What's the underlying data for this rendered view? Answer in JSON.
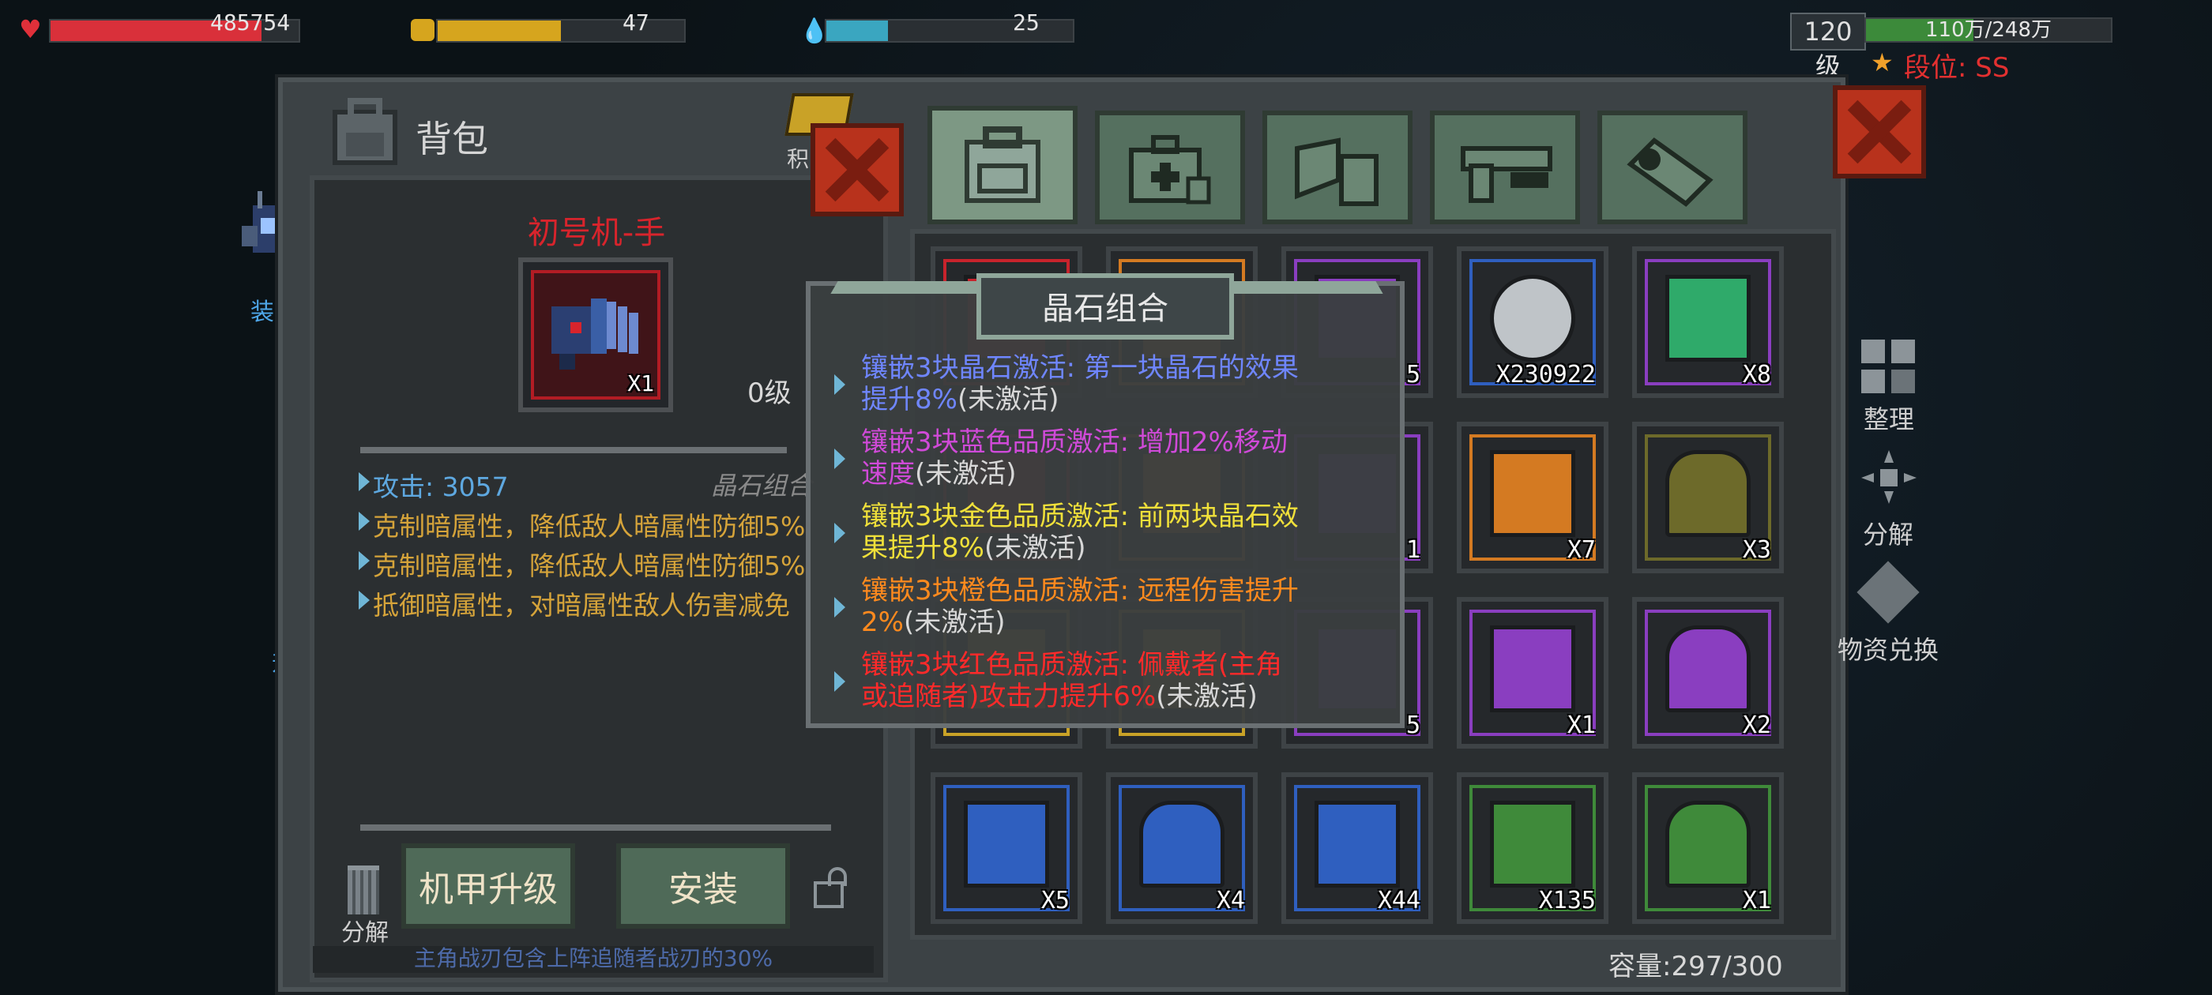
{
  "hud": {
    "hp_value": "485754",
    "food_value": "47",
    "water_value": "25",
    "hp_fraction": 0.85,
    "food_fraction": 0.5,
    "water_fraction": 0.25,
    "level_badge": "120级",
    "exp_text": "110万/248万",
    "exp_fraction": 0.44,
    "rank_label": "段位: SS",
    "colors": {
      "hp": "#d9303a",
      "food": "#d6a51e",
      "water": "#3aa6c0"
    }
  },
  "left_nav": {
    "equip_label": "装备",
    "upgrade_label": "升级",
    "peek_label": "积"
  },
  "backpack": {
    "title": "背包",
    "item_name": "初号机-手",
    "item_qty": "X1",
    "item_level": "0级",
    "stats": [
      {
        "text": "攻击: 3057",
        "color": "#5ea8e0"
      },
      {
        "text": "克制暗属性，降低敌人暗属性防御5%",
        "color": "#d6a43a"
      },
      {
        "text": "克制暗属性，降低敌人暗属性防御5%",
        "color": "#d6a43a"
      },
      {
        "text": "抵御暗属性，对暗属性敌人伤害减免",
        "color": "#d6a43a"
      }
    ],
    "gem_combo_label": "晶石组合",
    "footer_text": "主角战刃包含上阵追随者战刃的30%",
    "decompose_label": "分解",
    "upgrade_button": "机甲升级",
    "install_button": "安装"
  },
  "tabs": [
    "backpack-icon",
    "medkit-icon",
    "material-icon",
    "gun-icon",
    "wrench-icon"
  ],
  "tooltip": {
    "title": "晶石组合",
    "entries": [
      {
        "text": "镶嵌3块晶石激活: 第一块晶石的效果提升8%",
        "line1": "镶嵌3块晶石激活: 第一块晶石的效果",
        "line2": "提升8%",
        "status": "(未激活)",
        "color": "#6f86ff"
      },
      {
        "text": "镶嵌3块蓝色品质激活: 增加2%移动速度",
        "line1": "镶嵌3块蓝色品质激活: 增加2%移动",
        "line2": "速度",
        "status": "(未激活)",
        "color": "#d04ad8"
      },
      {
        "text": "镶嵌3块金色品质激活: 前两块晶石效果提升8%",
        "line1": "镶嵌3块金色品质激活: 前两块晶石效",
        "line2": "果提升8%",
        "status": "(未激活)",
        "color": "#f0e03a"
      },
      {
        "text": "镶嵌3块橙色品质激活: 远程伤害提升2%",
        "line1": "镶嵌3块橙色品质激活: 远程伤害提升",
        "line2": "2%",
        "status": "(未激活)",
        "color": "#ff8a1e"
      },
      {
        "text": "镶嵌3块红色品质激活: 佩戴者(主角或追随者)攻击力提升6%",
        "line1": "镶嵌3块红色品质激活: 佩戴者(主角",
        "line2": "或追随者)攻击力提升6%",
        "status": "(未激活)",
        "color": "#ff2a2a"
      }
    ]
  },
  "inventory": {
    "rows": [
      [
        {
          "icon": "hidden-item-icon",
          "rarity": "#c8232c",
          "qty": ""
        },
        {
          "icon": "hidden-item-icon",
          "rarity": "#d47a22",
          "qty": ""
        },
        {
          "icon": "hidden-item-icon",
          "rarity": "#8a3ec0",
          "qty": "5"
        },
        {
          "icon": "silver-coin-icon",
          "rarity": "#2f5fbf",
          "qty": "X230922"
        },
        {
          "icon": "green-tool-card-icon",
          "rarity": "#8a3ec0",
          "qty": "X8"
        }
      ],
      [
        {
          "icon": "hidden-item-icon",
          "rarity": "#c8232c",
          "qty": ""
        },
        {
          "icon": "hidden-item-icon",
          "rarity": "#d47a22",
          "qty": ""
        },
        {
          "icon": "hidden-item-icon",
          "rarity": "#8a3ec0",
          "qty": "1"
        },
        {
          "icon": "orange-crate-icon",
          "rarity": "#d47a22",
          "qty": "X7"
        },
        {
          "icon": "gold-chest-icon",
          "rarity": "#6d6a2a",
          "qty": "X3"
        }
      ],
      [
        {
          "icon": "hidden-item-icon",
          "rarity": "#c9a227",
          "qty": ""
        },
        {
          "icon": "hidden-item-icon",
          "rarity": "#c9a227",
          "qty": ""
        },
        {
          "icon": "hidden-item-icon",
          "rarity": "#8a3ec0",
          "qty": "5"
        },
        {
          "icon": "purple-box-icon",
          "rarity": "#8a3ec0",
          "qty": "X1"
        },
        {
          "icon": "purple-chest-icon",
          "rarity": "#8a3ec0",
          "qty": "X2"
        }
      ],
      [
        {
          "icon": "blue-green-box-icon",
          "rarity": "#2f5fbf",
          "qty": "X5"
        },
        {
          "icon": "blue-chest-icon",
          "rarity": "#2f5fbf",
          "qty": "X4"
        },
        {
          "icon": "blue-gold-box-icon",
          "rarity": "#2f5fbf",
          "qty": "X44"
        },
        {
          "icon": "green-box-icon",
          "rarity": "#3f8a3a",
          "qty": "X135"
        },
        {
          "icon": "gray-chest-icon",
          "rarity": "#3f8a3a",
          "qty": "X1"
        }
      ]
    ],
    "capacity": "容量:297/300"
  },
  "right_panel": {
    "sort_label": "整理",
    "decompose_label": "分解",
    "exchange_label": "物资兑换"
  }
}
